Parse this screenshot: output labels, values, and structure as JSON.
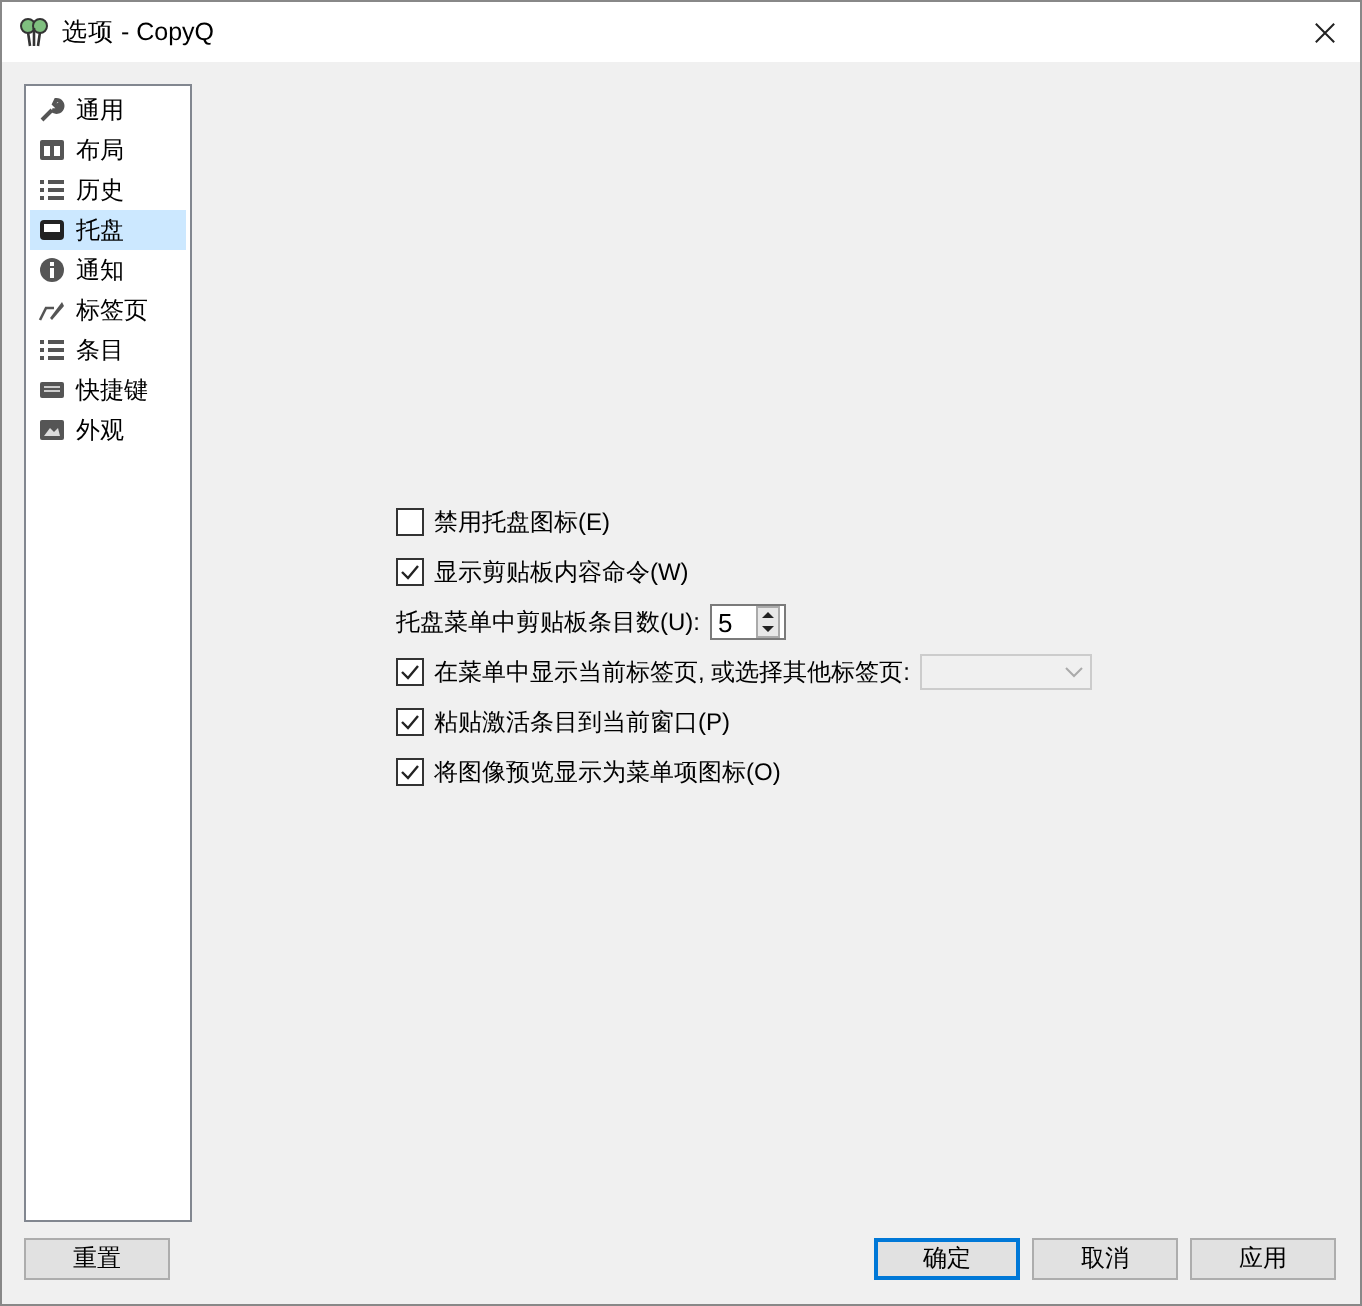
{
  "window": {
    "title": "选项 - CopyQ"
  },
  "sidebar": {
    "items": [
      {
        "label": "通用",
        "selected": false
      },
      {
        "label": "布局",
        "selected": false
      },
      {
        "label": "历史",
        "selected": false
      },
      {
        "label": "托盘",
        "selected": true
      },
      {
        "label": "通知",
        "selected": false
      },
      {
        "label": "标签页",
        "selected": false
      },
      {
        "label": "条目",
        "selected": false
      },
      {
        "label": "快捷键",
        "selected": false
      },
      {
        "label": "外观",
        "selected": false
      }
    ]
  },
  "options": [
    {
      "kind": "checkbox",
      "label": "禁用托盘图标(E)",
      "checked": false
    },
    {
      "kind": "checkbox",
      "label": "显示剪贴板内容命令(W)",
      "checked": true
    },
    {
      "kind": "spinbox",
      "label": "托盘菜单中剪贴板条目数(U):",
      "value": "5"
    },
    {
      "kind": "checkbox_combo",
      "label": "在菜单中显示当前标签页,  或选择其他标签页:",
      "checked": true
    },
    {
      "kind": "checkbox",
      "label": "粘贴激活条目到当前窗口(P)",
      "checked": true
    },
    {
      "kind": "checkbox",
      "label": "将图像预览显示为菜单项图标(O)",
      "checked": true
    }
  ],
  "buttons": {
    "reset": "重置",
    "ok": "确定",
    "cancel": "取消",
    "apply": "应用"
  }
}
